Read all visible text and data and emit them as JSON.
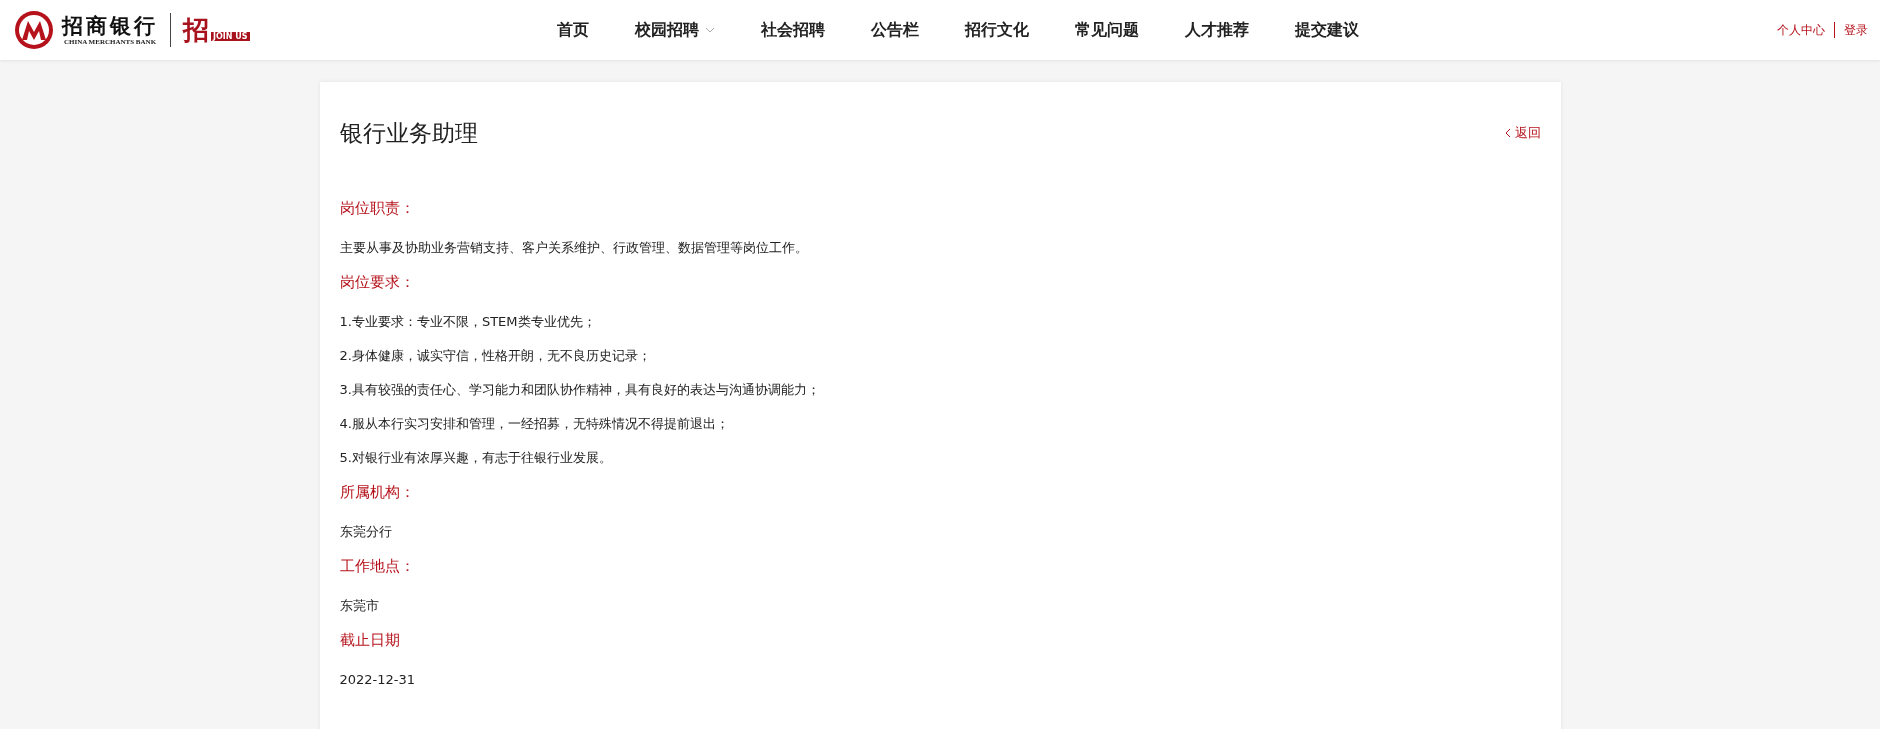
{
  "header": {
    "brand_cn": "招商银行",
    "brand_en": "CHINA MERCHANTS BANK",
    "campaign_char": "招",
    "campaign_tag": "JOIN US",
    "nav": [
      {
        "label": "首页",
        "dropdown": false
      },
      {
        "label": "校园招聘",
        "dropdown": true
      },
      {
        "label": "社会招聘",
        "dropdown": false
      },
      {
        "label": "公告栏",
        "dropdown": false
      },
      {
        "label": "招行文化",
        "dropdown": false
      },
      {
        "label": "常见问题",
        "dropdown": false
      },
      {
        "label": "人才推荐",
        "dropdown": false
      },
      {
        "label": "提交建议",
        "dropdown": false
      }
    ],
    "user_links": [
      "个人中心",
      "登录"
    ]
  },
  "job": {
    "title": "银行业务助理",
    "back": "返回",
    "sections": [
      {
        "heading": "岗位职责：",
        "lines": [
          "主要从事及协助业务营销支持、客户关系维护、行政管理、数据管理等岗位工作。"
        ]
      },
      {
        "heading": "岗位要求：",
        "lines": [
          "1.专业要求：专业不限，STEM类专业优先；",
          "2.身体健康，诚实守信，性格开朗，无不良历史记录；",
          "3.具有较强的责任心、学习能力和团队协作精神，具有良好的表达与沟通协调能力；",
          "4.服从本行实习安排和管理，一经招募，无特殊情况不得提前退出；",
          "5.对银行业有浓厚兴趣，有志于往银行业发展。"
        ]
      },
      {
        "heading": "所属机构：",
        "lines": [
          "东莞分行"
        ]
      },
      {
        "heading": "工作地点：",
        "lines": [
          "东莞市"
        ]
      },
      {
        "heading": "截止日期",
        "lines": [
          "2022-12-31"
        ]
      }
    ]
  }
}
